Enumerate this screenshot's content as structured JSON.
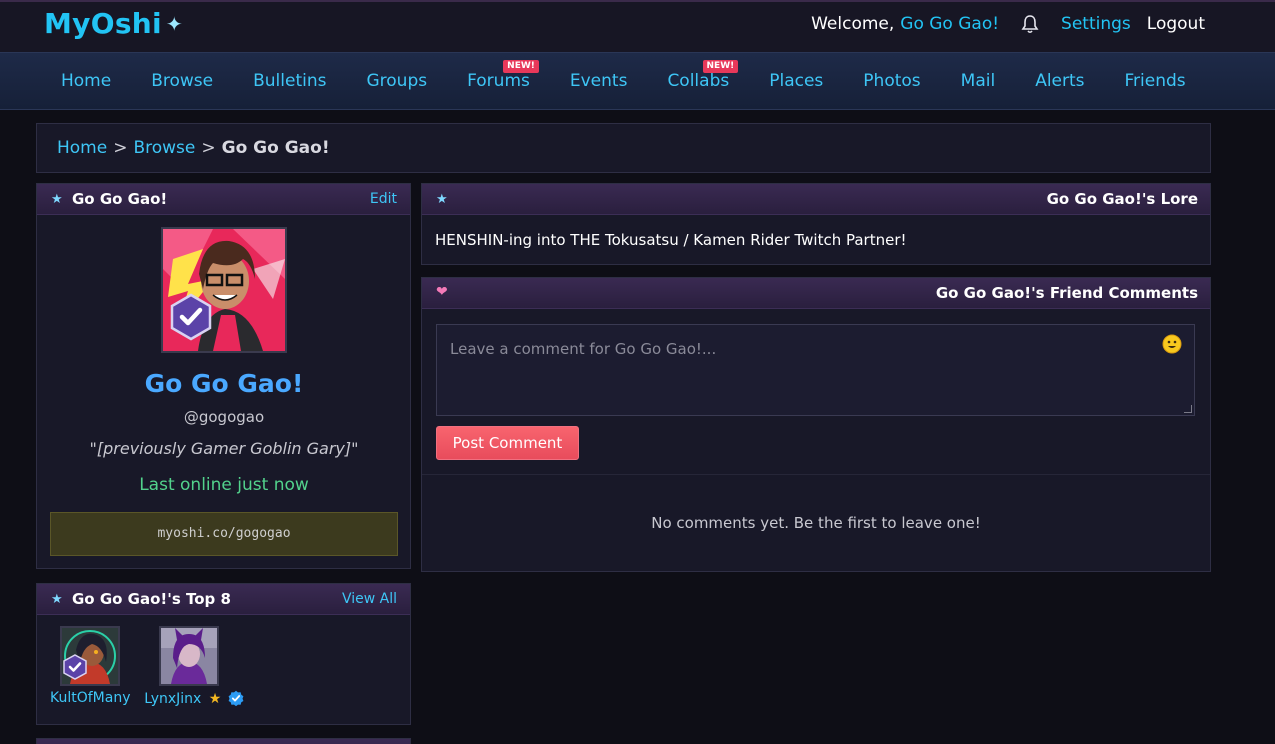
{
  "header": {
    "logo": "MyOshi",
    "welcome": "Welcome,",
    "username": "Go Go Gao!",
    "settings": "Settings",
    "logout": "Logout"
  },
  "nav": {
    "items": [
      {
        "label": "Home"
      },
      {
        "label": "Browse"
      },
      {
        "label": "Bulletins"
      },
      {
        "label": "Groups"
      },
      {
        "label": "Forums",
        "badge": "NEW!"
      },
      {
        "label": "Events"
      },
      {
        "label": "Collabs",
        "badge": "NEW!"
      },
      {
        "label": "Places"
      },
      {
        "label": "Photos"
      },
      {
        "label": "Mail"
      },
      {
        "label": "Alerts"
      },
      {
        "label": "Friends"
      }
    ]
  },
  "breadcrumb": {
    "home": "Home",
    "browse": "Browse",
    "current": "Go Go Gao!",
    "sep": ">"
  },
  "profile": {
    "header_title": "Go Go Gao!",
    "edit": "Edit",
    "display_name": "Go Go Gao!",
    "handle": "@gogogao",
    "tagline": "\"[previously Gamer Goblin Gary]\"",
    "last_online": "Last online just now",
    "url": "myoshi.co/gogogao"
  },
  "top8": {
    "title": "Go Go Gao!'s Top 8",
    "view_all": "View All",
    "friends": [
      {
        "name": "KultOfMany"
      },
      {
        "name": "LynxJinx"
      }
    ]
  },
  "lore": {
    "title": "Go Go Gao!'s Lore",
    "text": "HENSHIN-ing into THE Tokusatsu / Kamen Rider Twitch Partner!"
  },
  "comments": {
    "title": "Go Go Gao!'s Friend Comments",
    "placeholder": "Leave a comment for Go Go Gao!...",
    "post_button": "Post Comment",
    "empty": "No comments yet. Be the first to leave one!"
  },
  "colors": {
    "accent": "#22c4f4",
    "link": "#3ec6f6",
    "online": "#52d28c",
    "name": "#4aa8ff",
    "button": "#f0566a",
    "badge": "#e8385a"
  }
}
